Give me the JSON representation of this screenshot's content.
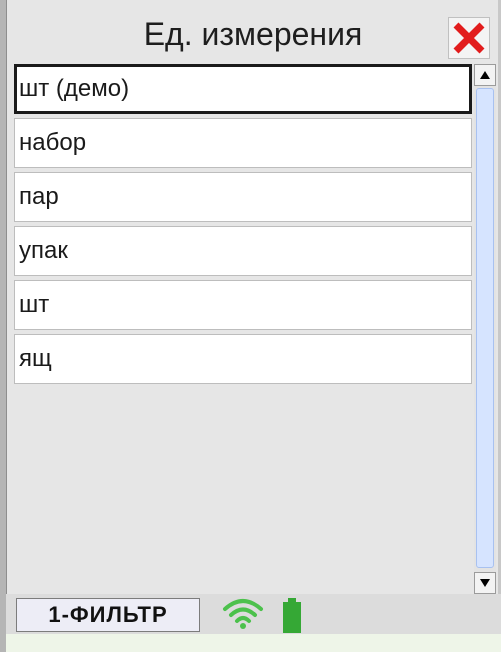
{
  "window": {
    "title": "Ед. измерения"
  },
  "units": [
    {
      "label": "шт (демо)",
      "selected": true
    },
    {
      "label": "набор",
      "selected": false
    },
    {
      "label": "пар",
      "selected": false
    },
    {
      "label": "упак",
      "selected": false
    },
    {
      "label": "шт",
      "selected": false
    },
    {
      "label": "ящ",
      "selected": false
    }
  ],
  "footer": {
    "filter_button": "1-ФИЛЬТР"
  },
  "icons": {
    "close": "close-icon",
    "wifi": "wifi-icon",
    "battery": "battery-icon",
    "scroll_up": "arrow-up-icon",
    "scroll_down": "arrow-down-icon"
  },
  "colors": {
    "close": "#e21c1c",
    "wifi": "#4cc14c",
    "battery": "#35a835",
    "scroll_thumb": "#d6e4ff"
  }
}
